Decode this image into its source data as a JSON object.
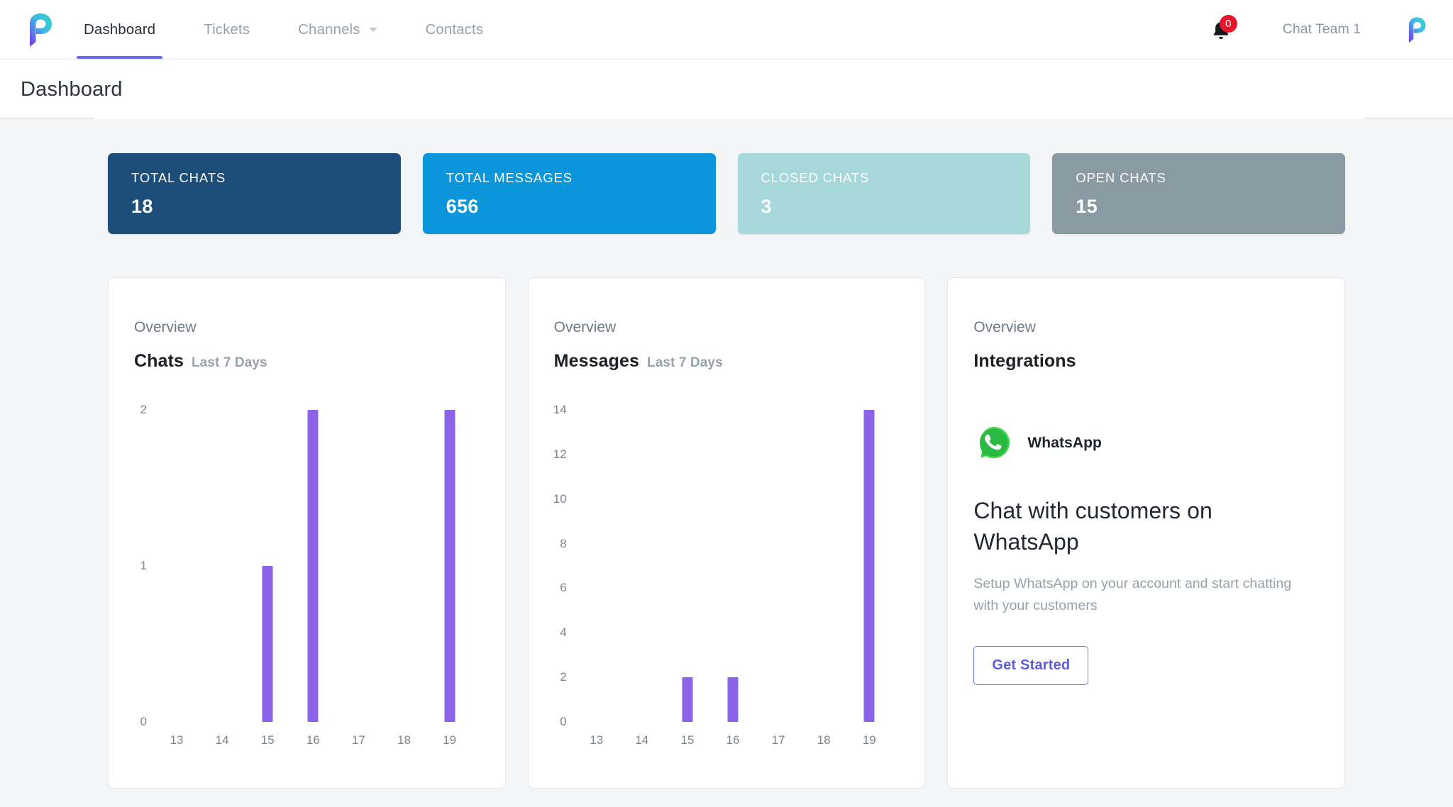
{
  "app": {
    "logo_icon": "pulse-p-logo",
    "brand_gradient_start": "#3fd4c0",
    "brand_gradient_end": "#7b3ff2"
  },
  "nav": {
    "items": [
      {
        "label": "Dashboard",
        "active": true,
        "has_caret": false
      },
      {
        "label": "Tickets",
        "active": false,
        "has_caret": false
      },
      {
        "label": "Channels",
        "active": false,
        "has_caret": true
      },
      {
        "label": "Contacts",
        "active": false,
        "has_caret": false
      }
    ],
    "active_underline_color": "#6b6bfa",
    "notifications": {
      "icon": "bell-icon",
      "count": "0",
      "badge_color": "#e8152a"
    },
    "team": "Chat Team 1",
    "avatar_icon": "pulse-p-logo"
  },
  "page": {
    "title": "Dashboard"
  },
  "stats": [
    {
      "label": "TOTAL CHATS",
      "value": "18",
      "color": "#1d4e79"
    },
    {
      "label": "TOTAL MESSAGES",
      "value": "656",
      "color": "#0b96dc"
    },
    {
      "label": "CLOSED CHATS",
      "value": "3",
      "color": "#a6d8da"
    },
    {
      "label": "OPEN CHATS",
      "value": "15",
      "color": "#8a9aa2"
    }
  ],
  "panels": {
    "chats": {
      "eyebrow": "Overview",
      "heading": "Chats",
      "subheading": "Last 7 Days"
    },
    "messages": {
      "eyebrow": "Overview",
      "heading": "Messages",
      "subheading": "Last 7 Days"
    },
    "integrations": {
      "eyebrow": "Overview",
      "heading": "Integrations",
      "provider_name": "WhatsApp",
      "provider_icon": "whatsapp-icon",
      "promo_title": "Chat with customers on WhatsApp",
      "promo_subtitle": "Setup WhatsApp on your account and start chatting with your customers",
      "cta_label": "Get Started",
      "cta_color": "#5c5ce0"
    }
  },
  "chart_data": [
    {
      "type": "bar",
      "id": "chats",
      "title": "Chats",
      "subtitle": "Last 7 Days",
      "categories": [
        "13",
        "14",
        "15",
        "16",
        "17",
        "18",
        "19"
      ],
      "values": [
        0,
        0,
        1,
        2,
        0,
        0,
        2
      ],
      "xlabel": "",
      "ylabel": "",
      "ylim": [
        0,
        2
      ],
      "yticks": [
        0,
        1,
        2
      ],
      "grid": false,
      "legend": false,
      "bar_color": "#8a63e8"
    },
    {
      "type": "bar",
      "id": "messages",
      "title": "Messages",
      "subtitle": "Last 7 Days",
      "categories": [
        "13",
        "14",
        "15",
        "16",
        "17",
        "18",
        "19"
      ],
      "values": [
        0,
        0,
        2,
        2,
        0,
        0,
        14
      ],
      "xlabel": "",
      "ylabel": "",
      "ylim": [
        0,
        14
      ],
      "yticks": [
        0,
        2,
        4,
        6,
        8,
        10,
        12,
        14
      ],
      "grid": false,
      "legend": false,
      "bar_color": "#8a63e8"
    }
  ]
}
